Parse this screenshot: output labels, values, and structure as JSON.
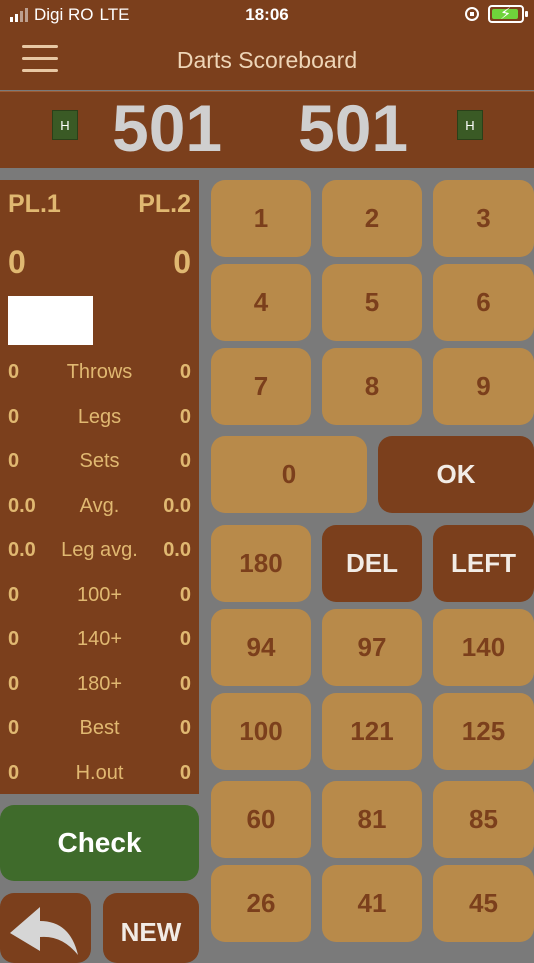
{
  "status_bar": {
    "carrier": "Digi RO",
    "network": "LTE",
    "time": "18:06"
  },
  "header": {
    "title": "Darts Scoreboard"
  },
  "scoreboard": {
    "p1_score": "501",
    "p2_score": "501",
    "p1_badge": "H",
    "p2_badge": "H"
  },
  "panel": {
    "p1_label": "PL.1",
    "p2_label": "PL.2",
    "p1_points": "0",
    "p2_points": "0",
    "stats": [
      {
        "name": "Throws",
        "p1": "0",
        "p2": "0"
      },
      {
        "name": "Legs",
        "p1": "0",
        "p2": "0"
      },
      {
        "name": "Sets",
        "p1": "0",
        "p2": "0"
      },
      {
        "name": "Avg.",
        "p1": "0.0",
        "p2": "0.0"
      },
      {
        "name": "Leg avg.",
        "p1": "0.0",
        "p2": "0.0"
      },
      {
        "name": "100+",
        "p1": "0",
        "p2": "0"
      },
      {
        "name": "140+",
        "p1": "0",
        "p2": "0"
      },
      {
        "name": "180+",
        "p1": "0",
        "p2": "0"
      },
      {
        "name": "Best",
        "p1": "0",
        "p2": "0"
      },
      {
        "name": "H.out",
        "p1": "0",
        "p2": "0"
      }
    ]
  },
  "buttons": {
    "check": "Check",
    "new": "NEW",
    "back_icon": "undo-arrow-icon"
  },
  "keypad": {
    "digits": [
      "1",
      "2",
      "3",
      "4",
      "5",
      "6",
      "7",
      "8",
      "9"
    ],
    "zero": "0",
    "ok": "OK",
    "k180": "180",
    "del": "DEL",
    "left": "LEFT",
    "quick": [
      "94",
      "97",
      "140",
      "100",
      "121",
      "125",
      "60",
      "81",
      "85",
      "26",
      "41",
      "45"
    ]
  },
  "colors": {
    "brown": "#7b3f1c",
    "tan": "#b88a4a",
    "green": "#3f6b2b",
    "grey": "#7a7a7a",
    "gold": "#e0b871"
  }
}
